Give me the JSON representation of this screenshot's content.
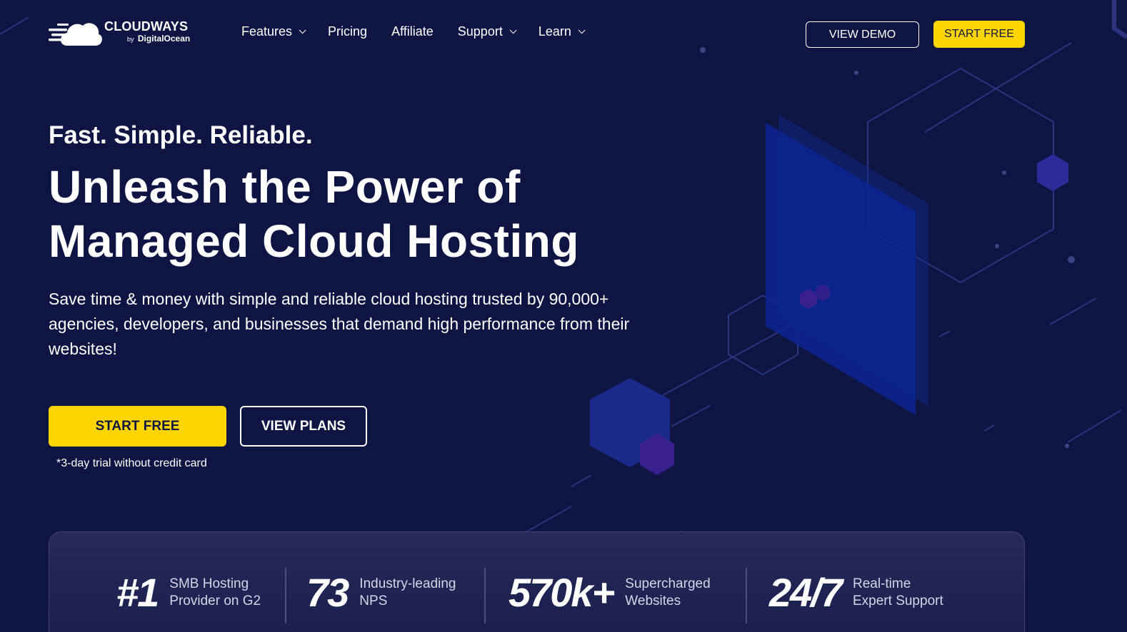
{
  "brand": {
    "name": "CLOUDWAYS",
    "by": "by",
    "parent": "DigitalOcean"
  },
  "nav": {
    "items": [
      {
        "label": "Features",
        "has_dropdown": true
      },
      {
        "label": "Pricing",
        "has_dropdown": false
      },
      {
        "label": "Affiliate",
        "has_dropdown": false
      },
      {
        "label": "Support",
        "has_dropdown": true
      },
      {
        "label": "Learn",
        "has_dropdown": true
      }
    ],
    "view_demo": "VIEW DEMO",
    "start_free": "START FREE"
  },
  "hero": {
    "eyebrow": "Fast. Simple. Reliable.",
    "headline_line1": "Unleash the Power of",
    "headline_line2": "Managed Cloud Hosting",
    "subtext": "Save time & money with simple and reliable cloud hosting trusted by 90,000+ agencies, developers, and businesses that demand high performance from their websites!",
    "cta_primary": "START FREE",
    "cta_secondary": "VIEW PLANS",
    "trial_note": "*3-day trial without credit card"
  },
  "stats": [
    {
      "value": "#1",
      "label_line1": "SMB Hosting",
      "label_line2": "Provider on G2"
    },
    {
      "value": "73",
      "label_line1": "Industry-leading",
      "label_line2": "NPS"
    },
    {
      "value": "570k+",
      "label_line1": "Supercharged",
      "label_line2": "Websites"
    },
    {
      "value": "24/7",
      "label_line1": "Real-time",
      "label_line2": "Expert Support"
    }
  ],
  "colors": {
    "background": "#0f1543",
    "accent": "#ffd500",
    "text": "#ffffff"
  }
}
